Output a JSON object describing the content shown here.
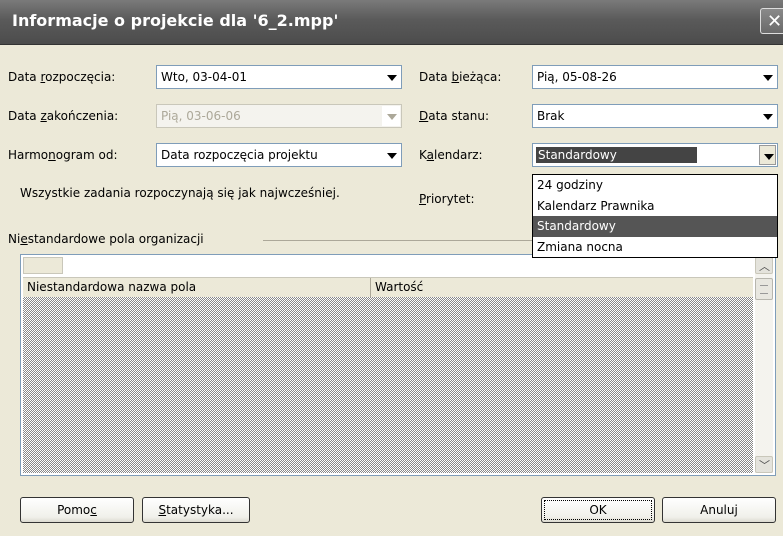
{
  "window": {
    "title": "Informacje o projekcie dla '6_2.mpp'",
    "close_glyph": "✕"
  },
  "form": {
    "start_date": {
      "label_pre": "Data ",
      "label_key": "r",
      "label_post": "ozpoczęcia:",
      "value": "Wto, 03-04-01"
    },
    "finish_date": {
      "label_pre": "Data ",
      "label_key": "z",
      "label_post": "akończenia:",
      "value": "Pią, 03-06-06"
    },
    "schedule_from": {
      "label_pre": "Harmo",
      "label_key": "n",
      "label_post": "ogram od:",
      "value": "Data rozpoczęcia projektu"
    },
    "schedule_note": "Wszystkie zadania rozpoczynają się jak najwcześniej.",
    "current_date": {
      "label_pre": "Data ",
      "label_key": "b",
      "label_post": "ieżąca:",
      "value": "Pią, 05-08-26"
    },
    "status_date": {
      "label_pre": "",
      "label_key": "D",
      "label_post": "ata stanu:",
      "value": "Brak"
    },
    "calendar": {
      "label_pre": "K",
      "label_key": "a",
      "label_post": "lendarz:",
      "value": "Standardowy"
    },
    "priority": {
      "label_pre": "",
      "label_key": "P",
      "label_post": "riorytet:"
    }
  },
  "calendar_dropdown": {
    "options": [
      "24 godziny",
      "Kalendarz Prawnika",
      "Standardowy",
      "Zmiana nocna"
    ],
    "selected": "Standardowy"
  },
  "custom_fields": {
    "group_label_pre": "Ni",
    "group_label_key": "e",
    "group_label_post": "standardowe pola organizacji",
    "col_name": "Niestandardowa nazwa pola",
    "col_value": "Wartość"
  },
  "buttons": {
    "help_pre": "Pomo",
    "help_key": "c",
    "stats_key": "S",
    "stats_post": "tatystyka...",
    "ok": "OK",
    "cancel": "Anuluj"
  },
  "colors": {
    "titlebar": "#5a5a5a",
    "dialog_bg": "#ece9d8",
    "selection": "#555555"
  }
}
